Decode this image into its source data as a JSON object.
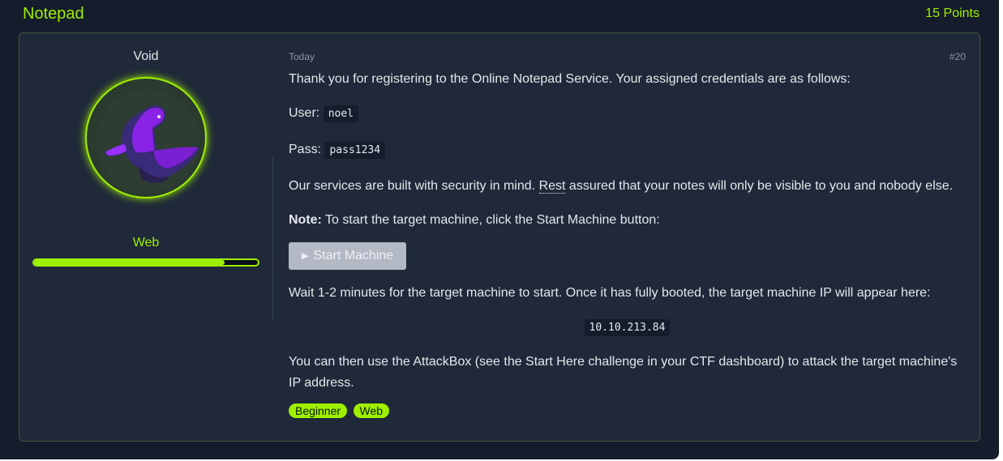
{
  "header": {
    "title": "Notepad",
    "points": "15 Points"
  },
  "author": {
    "username": "Void",
    "category": "Web",
    "progress": 0.85
  },
  "post": {
    "date": "Today",
    "number": "#20",
    "intro": "Thank you for registering to the Online Notepad Service. Your assigned credentials are as follows:",
    "user_label": "User:",
    "user_value": "noel",
    "pass_label": "Pass:",
    "pass_value": "pass1234",
    "security_before": "Our services are built with security in mind.",
    "security_rest": "Rest",
    "security_after": "assured that your notes will only be visible to you and nobody else.",
    "note_label": "Note:",
    "note_text": "To start the target machine, click the Start Machine button:",
    "start_button": "Start Machine",
    "wait_text": "Wait 1-2 minutes for the target machine to start. Once it has fully booted, the target machine IP will appear here:",
    "ip": "10.10.213.84",
    "attack_text": "You can then use the AttackBox (see the Start Here challenge in your CTF dashboard) to attack the target machine's IP address.",
    "tags": [
      "Beginner",
      "Web"
    ]
  },
  "colors": {
    "accent": "#9fef00",
    "card": "#1f2939",
    "background": "#151c2b"
  },
  "icons": {
    "play": "play-icon"
  }
}
